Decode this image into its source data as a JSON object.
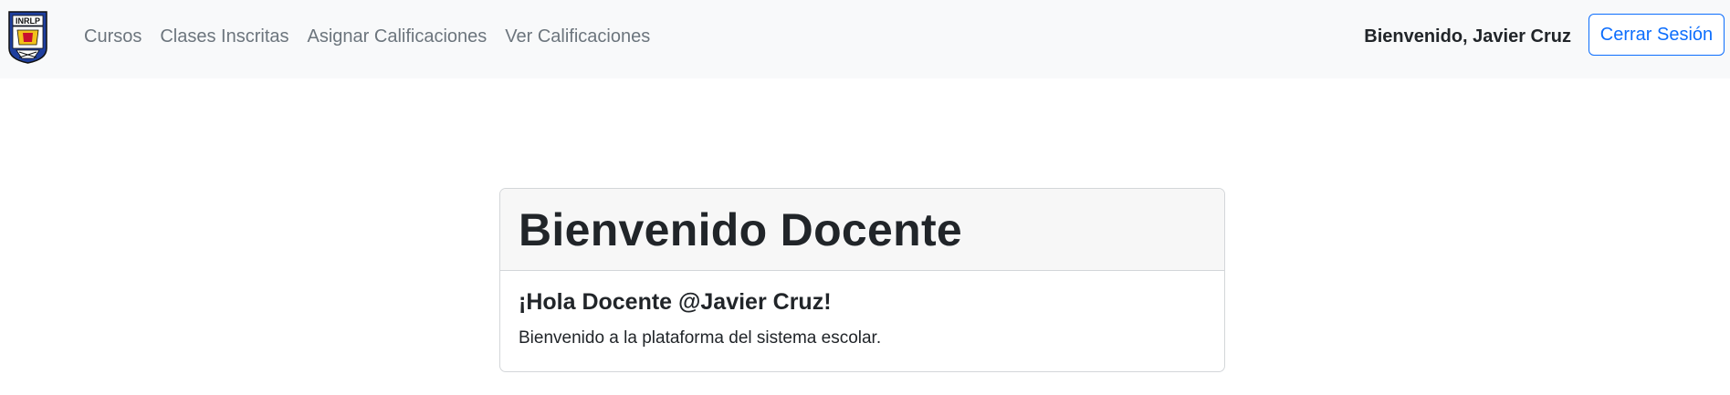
{
  "navbar": {
    "links": [
      "Cursos",
      "Clases Inscritas",
      "Asignar Calificaciones",
      "Ver Calificaciones"
    ],
    "welcome_text": "Bienvenido, Javier Cruz",
    "logout_label": "Cerrar Sesión",
    "logo_text": "INRLP",
    "logo_icon": "school-crest-icon"
  },
  "card": {
    "header_title": "Bienvenido Docente",
    "greeting": "¡Hola Docente @Javier Cruz!",
    "message": "Bienvenido a la plataforma del sistema escolar."
  },
  "colors": {
    "navbar_bg": "#f8f9fa",
    "primary": "#0d6efd",
    "nav_link": "#6c757d",
    "card_header_bg": "#f7f7f7"
  }
}
